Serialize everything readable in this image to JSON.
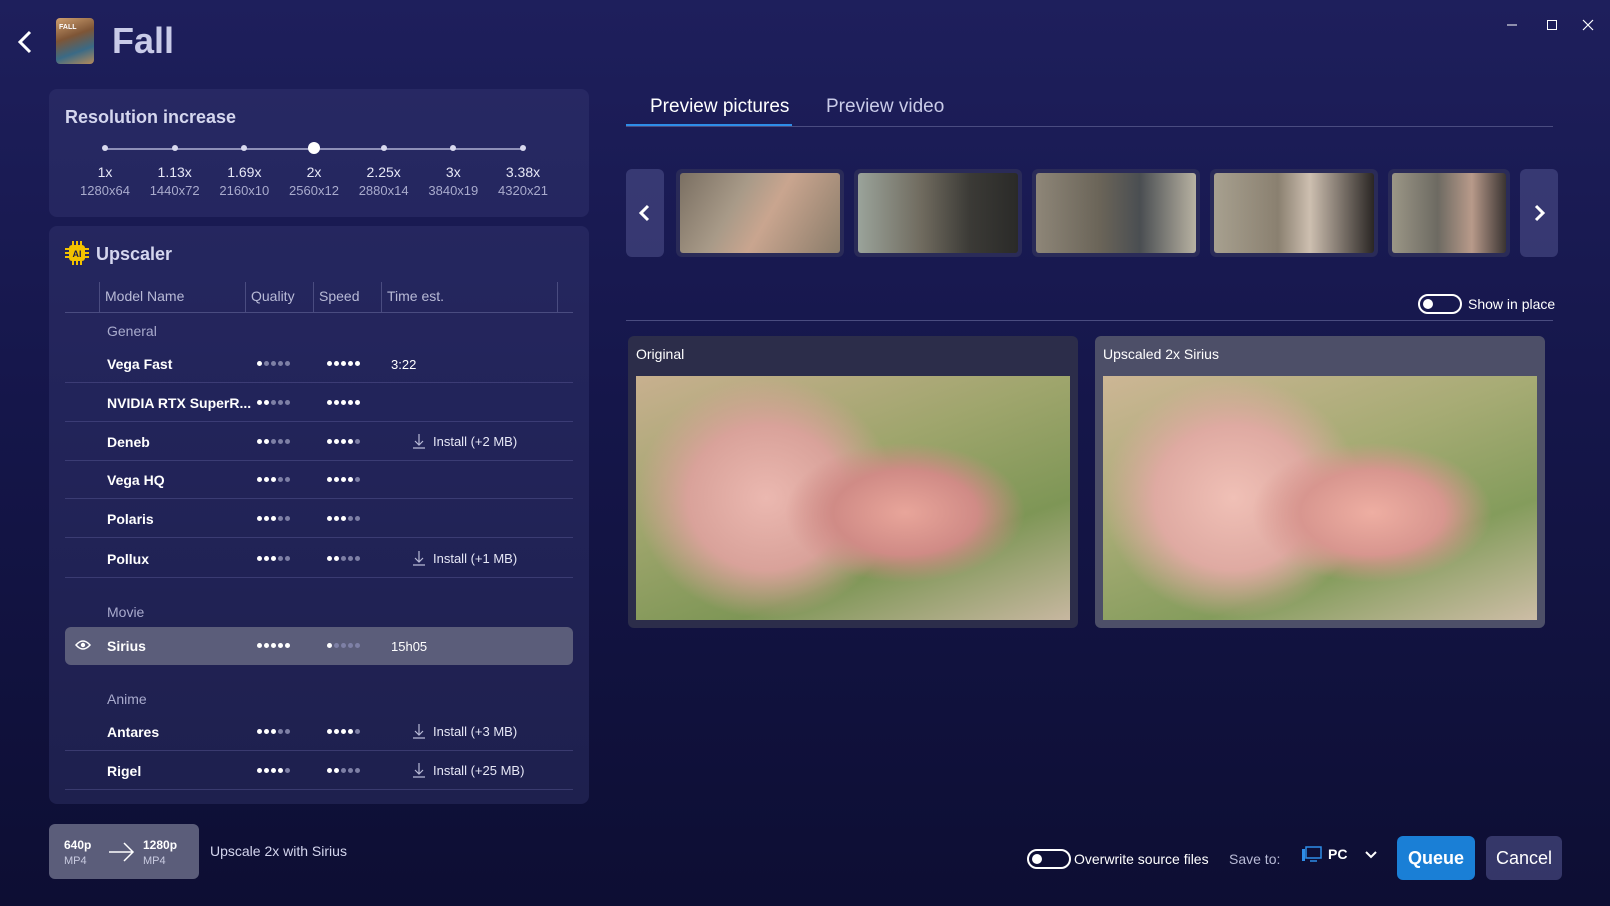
{
  "header": {
    "title": "Fall",
    "thumb_text": "FALL"
  },
  "resolution": {
    "title": "Resolution increase",
    "steps": [
      {
        "label": "1x",
        "sub": "1280x64"
      },
      {
        "label": "1.13x",
        "sub": "1440x72"
      },
      {
        "label": "1.69x",
        "sub": "2160x10"
      },
      {
        "label": "2x",
        "sub": "2560x12"
      },
      {
        "label": "2.25x",
        "sub": "2880x14"
      },
      {
        "label": "3x",
        "sub": "3840x19"
      },
      {
        "label": "3.38x",
        "sub": "4320x21"
      }
    ],
    "selected": "2x"
  },
  "upscaler": {
    "title": "Upscaler",
    "columns": [
      "Model Name",
      "Quality",
      "Speed",
      "Time est."
    ],
    "groups": [
      "General",
      "Movie",
      "Anime"
    ],
    "models": [
      {
        "name": "Vega Fast",
        "quality": 1,
        "speed": 5,
        "time": "3:22",
        "install": ""
      },
      {
        "name": "NVIDIA RTX SuperR...",
        "quality": 2,
        "speed": 5,
        "time": "",
        "install": ""
      },
      {
        "name": "Deneb",
        "quality": 2,
        "speed": 4,
        "time": "",
        "install": "Install (+2 MB)"
      },
      {
        "name": "Vega HQ",
        "quality": 3,
        "speed": 4,
        "time": "",
        "install": ""
      },
      {
        "name": "Polaris",
        "quality": 3,
        "speed": 3,
        "time": "",
        "install": ""
      },
      {
        "name": "Pollux",
        "quality": 3,
        "speed": 2,
        "time": "",
        "install": "Install (+1 MB)"
      },
      {
        "name": "Sirius",
        "quality": 5,
        "speed": 1,
        "time": "15h05",
        "install": "",
        "selected": true
      },
      {
        "name": "Antares",
        "quality": 3,
        "speed": 4,
        "time": "",
        "install": "Install (+3 MB)"
      },
      {
        "name": "Rigel",
        "quality": 4,
        "speed": 2,
        "time": "",
        "install": "Install (+25 MB)"
      }
    ]
  },
  "tabs": [
    "Preview pictures",
    "Preview video"
  ],
  "show_in_place_label": "Show in place",
  "preview": {
    "original_label": "Original",
    "upscaled_label": "Upscaled 2x Sirius"
  },
  "bottom": {
    "from_res": "640p",
    "from_fmt": "MP4",
    "to_res": "1280p",
    "to_fmt": "MP4",
    "summary": "Upscale 2x with Sirius",
    "overwrite_label": "Overwrite source files",
    "save_to_label": "Save to:",
    "save_to_value": "PC",
    "queue_label": "Queue",
    "cancel_label": "Cancel"
  },
  "colors": {
    "accent": "#1a7fd6",
    "tab_underline": "#2e8de8",
    "selected_row": "#5b5d7a"
  },
  "icons": [
    "back-icon",
    "minimize-icon",
    "maximize-icon",
    "close-icon",
    "ai-chip-icon",
    "eye-icon",
    "download-icon",
    "chevron-left-icon",
    "chevron-right-icon",
    "pc-icon",
    "chevron-down-icon",
    "arrow-right-icon"
  ]
}
